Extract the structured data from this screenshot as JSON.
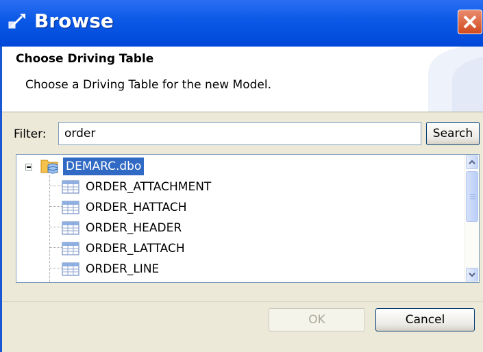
{
  "window": {
    "title": "Browse",
    "title_icon": "browse-icon",
    "close_icon": "close-icon",
    "titlebar_color": "#0a58e6",
    "close_color": "#d04a1e"
  },
  "header": {
    "title": "Choose Driving Table",
    "description": "Choose a Driving Table for the new Model."
  },
  "filter": {
    "label": "Filter:",
    "value": "order",
    "search_label": "Search"
  },
  "tree": {
    "root": {
      "label": "DEMARC.dbo",
      "icon": "database-folder-icon",
      "expanded": true,
      "selected": true
    },
    "items": [
      {
        "label": "ORDER_ATTACHMENT",
        "icon": "table-icon"
      },
      {
        "label": "ORDER_HATTACH",
        "icon": "table-icon"
      },
      {
        "label": "ORDER_HEADER",
        "icon": "table-icon"
      },
      {
        "label": "ORDER_LATTACH",
        "icon": "table-icon"
      },
      {
        "label": "ORDER_LINE",
        "icon": "table-icon"
      }
    ],
    "selection_color": "#316ac5"
  },
  "buttons": {
    "ok": {
      "label": "OK",
      "enabled": false
    },
    "cancel": {
      "label": "Cancel",
      "enabled": true
    }
  }
}
